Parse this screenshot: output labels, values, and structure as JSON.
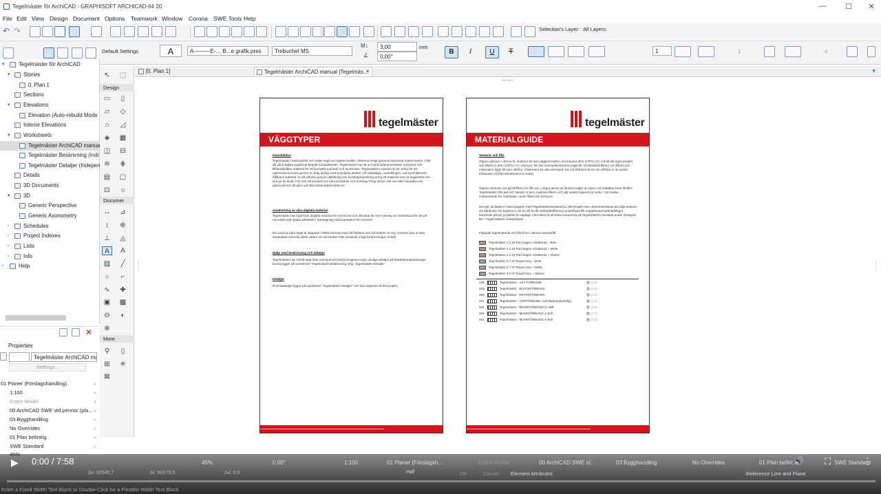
{
  "window": {
    "title": "Tegelmäster för ArchiCAD - GRAPHISOFT ARCHICAD-64 20",
    "min": "—",
    "max": "☐",
    "close": "✕"
  },
  "menu": [
    "File",
    "Edit",
    "View",
    "Design",
    "Document",
    "Options",
    "Teamwork",
    "Window",
    "Corona",
    "SWE Tools",
    "Help"
  ],
  "toolbar": {
    "selections_layer": "Selection's Layer:",
    "all_layers": "All Layers:",
    "default_settings": "Default Settings",
    "pen_set": "A———E-… B...e grafik.pres",
    "font": "Trebuchet MS",
    "size_value": "3,00",
    "size_unit": "mm",
    "angle_value": "0,00°",
    "bold": "B",
    "italic": "I",
    "underline": "U",
    "strike": "T",
    "pen1": "1",
    "pen_neg": "-1",
    "pen_1b": "1"
  },
  "navigator": {
    "rows": [
      {
        "label": "Tegelmäster för ArchiCAD",
        "level": 0,
        "arrow": "▾"
      },
      {
        "label": "Stories",
        "level": 1,
        "arrow": "▾"
      },
      {
        "label": "0. Plan 1",
        "level": 2,
        "arrow": ""
      },
      {
        "label": "Sections",
        "level": 1,
        "arrow": ""
      },
      {
        "label": "Elevations",
        "level": 1,
        "arrow": "▾"
      },
      {
        "label": "Elevation (Auto-rebuild Mode",
        "level": 2,
        "arrow": ""
      },
      {
        "label": "Interior Elevations",
        "level": 1,
        "arrow": ""
      },
      {
        "label": "Worksheets",
        "level": 1,
        "arrow": "▾"
      },
      {
        "label": "Tegelmäster ArchiCAD manua",
        "level": 2,
        "arrow": "",
        "selected": true
      },
      {
        "label": "Tegelmäster Beskrivning (Indi",
        "level": 2,
        "arrow": ""
      },
      {
        "label": "Tegelmäster Detaljer (Indepen",
        "level": 2,
        "arrow": ""
      },
      {
        "label": "Details",
        "level": 1,
        "arrow": ""
      },
      {
        "label": "3D Documents",
        "level": 1,
        "arrow": ""
      },
      {
        "label": "3D",
        "level": 1,
        "arrow": "▾"
      },
      {
        "label": "Generic Perspective",
        "level": 2,
        "arrow": ""
      },
      {
        "label": "Generic Axonometry",
        "level": 2,
        "arrow": ""
      },
      {
        "label": "Schedules",
        "level": 1,
        "arrow": "›"
      },
      {
        "label": "Project Indexes",
        "level": 1,
        "arrow": "›"
      },
      {
        "label": "Lists",
        "level": 1,
        "arrow": "›"
      },
      {
        "label": "Info",
        "level": 1,
        "arrow": "›"
      },
      {
        "label": "Help",
        "level": 0,
        "arrow": "›"
      }
    ]
  },
  "toolbox": {
    "design": "Design",
    "document": "Documer",
    "more": "More"
  },
  "properties": {
    "header": "Properties",
    "name": "Tegelmäster ArchiCAD man",
    "settings": "Settings...",
    "rows": [
      "01 Planer (Förslagshandling)",
      "1:100",
      "Entire Model",
      "00 ArchiCAD SWE std.pennor (pla...",
      "03 Bygghandling",
      "No Overrides",
      "01 Plan befintlig",
      "SWE Standard",
      "45%"
    ]
  },
  "tabs": [
    {
      "label": "[0. Plan 1]"
    },
    {
      "label": "Tegelmäster ArchiCAD manual [Tegelmäs...",
      "close": "✕"
    }
  ],
  "page_left": {
    "logo": "tegelmäster",
    "banner": "VÄGGTYPER",
    "sections": [
      {
        "heading": "Introduktion",
        "body": "Tegelmäster marknadsför och säljer tegel av högsta kvalitet, tillverkat enligt gammal beprövad metod sedan 1750 då vårat äldsta tegelbruk började produktionen. Tegelmäster har ett av marknadens bredaste sortiment och tillhandahåller material för ett komplett murverk och murbruket. Tegelmästers mission är att verka för ett optimerat murverk genom en tidig dialog med projektets aktörer och delaktiga i utvecklingen i ett samhällemed hållbara material. Vi vill influera genom utbildning och kunskapsspridning kring ett material som är hygieniskt och ska ge liv ändå. För mer information om våra produkter och kunskap kring dessa, läs mer eller kontakta oss gärna genom att gå in på http://www.tegelmaster.se"
      },
      {
        "heading": "Användning av våra digitala material",
        "body": "Tegelmäster har tagit fram digitala material för ArchiCAD och tillverkat för som vinning av murförband för att på ett enkelt sätt hjälpa arkitekter i framtagning dokumentation för murverk."
      },
      {
        "heading": "",
        "body": "Ett urval av våra tegel är skapade i detta koncept med vilt förband och två kulörer av fog. Givetvis kan ni som användare utveckla detta vidare om så önskas eller använda enligt beskrivningen nedan."
      },
      {
        "heading": "Hjälp med beskrivning och detaljer",
        "body": "Tegelmäster har också tagit fram exempel på beskrivningstext samt vanliga detaljer på förstörtkonstruktionger. Dessa ligger på worksheet \"Tegelmäster Beskrivning resp. Tegelmäster Detaljer\"."
      },
      {
        "heading": "Detaljer",
        "body": "Principdetaljer ligger på worksheet \"Tegelmäster Detaljer\" och kan kopieras till ditt projekt."
      }
    ]
  },
  "page_right": {
    "logo": "tegelmäster",
    "banner": "MATERIALGUIDE",
    "sections": [
      {
        "heading": "Texturer och fills",
        "body": "Öppna planvyn i denna fil, markera de sex väggexemplen och kopiera dem (CRTL+C). Gå till ditt egna projekt och klistra in dem (CRTL+V) i planvyn. Nu har exempeltexturerna lagts till i Embedded library och fillsen och materialen lagts till som attribut. Observera att alla exempeln har vilt förband så om du vill läsa in de andra förbanden så följ instruktionerna nedan."
      },
      {
        "heading": "",
        "body": "Öppna Attribute och gå till fliken för fills och i högra deren av fönstret väljer du Open och bläddrar fram till filen Tegelmäster Fills.aat och hämtar in den. Avaktera fliken och välj sedan Append by Index. Gör sedan motsvarande för materialen under fliken för Surfaces."
      },
      {
        "heading": "",
        "body": "Det går att ladda in hela mappen med Tegelmästerstexturerna i ditt projekt men rekommenderas att välja texturer via attributet och kopiera in de du vill ha till embeddedlibrary/ projektspecifik mapp/texturmarknadslager beroende på hur projektet är upplagt. Alternativt är att testa texturerna på Tegelmästers hemsida under Designa/ Bli > Tegelmästers Hussledgner."
      },
      {
        "heading": "",
        "body": "Följande tegelmaterial och fills finns i denna exempelfil:"
      }
    ],
    "swatches": [
      "Tegelmäster 2.2.16 Röd slagen schatterad + Brite",
      "Tegelmäster 2.2.16 Röd slagen schatterad + Melle",
      "Tegelmäster 2.2.16 Röd slagen schatterad + Skarnc",
      "Tegelmäster 3.7.37 Royal Grey + Brite",
      "Tegelmäster 3.7.37 Royal Grey + Melle",
      "Tegelmäster 3.7.37 Royal Grey + Skarnc"
    ],
    "fills": [
      {
        "num": "258",
        "label": "Tegelmäster - VILT FÖRBAND"
      },
      {
        "num": "259",
        "label": "Tegelmäster - BLOCKFÖRBAND"
      },
      {
        "num": "260",
        "label": "Tegelmäster - KRYSSFÖRBAND"
      },
      {
        "num": "261",
        "label": "Tegelmäster - LÖPFÖRBAND, överlappningsrandigt"
      },
      {
        "num": "262",
        "label": "Tegelmäster - MUNKFÖRBAND (1-skift"
      },
      {
        "num": "263",
        "label": "Tegelmäster - MUNKFÖRBAND 2-skift"
      },
      {
        "num": "264",
        "label": "Tegelmäster - MUNKFÖRBAND 4-skift"
      }
    ]
  },
  "statusbar": {
    "zoom": "45%",
    "angle": "0,00°",
    "scale": "1:100",
    "layer": "01 Planer (Förslagsh...",
    "model": "Entire Model",
    "pens": "00 ArchiCAD SWE st...",
    "phase": "03 Bygghandling",
    "overrides": "No Overrides",
    "reno": "01 Plan befint",
    "std": "SWE Standard",
    "dx": "Δx: 60946,7",
    "dr": "Δr: 60979,5",
    "da": "Δα: 0,0",
    "half": "Half",
    "ok": "OK",
    "cancel": "Cancel",
    "element_attr": "Element Attributes",
    "ref_line": "Reference Line and Plane",
    "hint": "Enter a Fixed Width Text Block or Double-Click for a Flexible Width Text Block"
  },
  "video": {
    "time": "0:00 / 7:58",
    "play": "▶"
  }
}
